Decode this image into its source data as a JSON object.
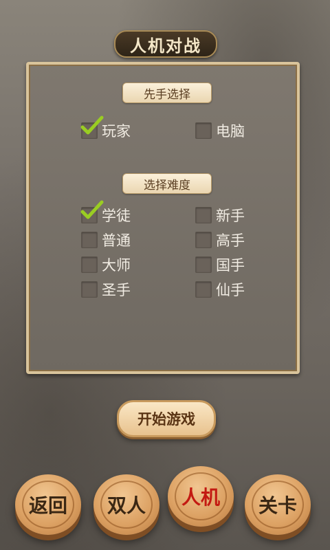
{
  "header": {
    "title": "人机对战"
  },
  "first_move": {
    "label": "先手选择",
    "options": [
      {
        "label": "玩家",
        "checked": true
      },
      {
        "label": "电脑",
        "checked": false
      }
    ]
  },
  "difficulty": {
    "label": "选择难度",
    "options": [
      {
        "label": "学徒",
        "checked": true
      },
      {
        "label": "新手",
        "checked": false
      },
      {
        "label": "普通",
        "checked": false
      },
      {
        "label": "高手",
        "checked": false
      },
      {
        "label": "大师",
        "checked": false
      },
      {
        "label": "国手",
        "checked": false
      },
      {
        "label": "圣手",
        "checked": false
      },
      {
        "label": "仙手",
        "checked": false
      }
    ]
  },
  "start_button": {
    "label": "开始游戏"
  },
  "bottom_nav": {
    "items": [
      {
        "label": "返回",
        "active": false
      },
      {
        "label": "双人",
        "active": false
      },
      {
        "label": "人机",
        "active": true
      },
      {
        "label": "关卡",
        "active": false
      }
    ]
  },
  "colors": {
    "accent_red": "#c31a12",
    "check_green": "#9acd22"
  }
}
